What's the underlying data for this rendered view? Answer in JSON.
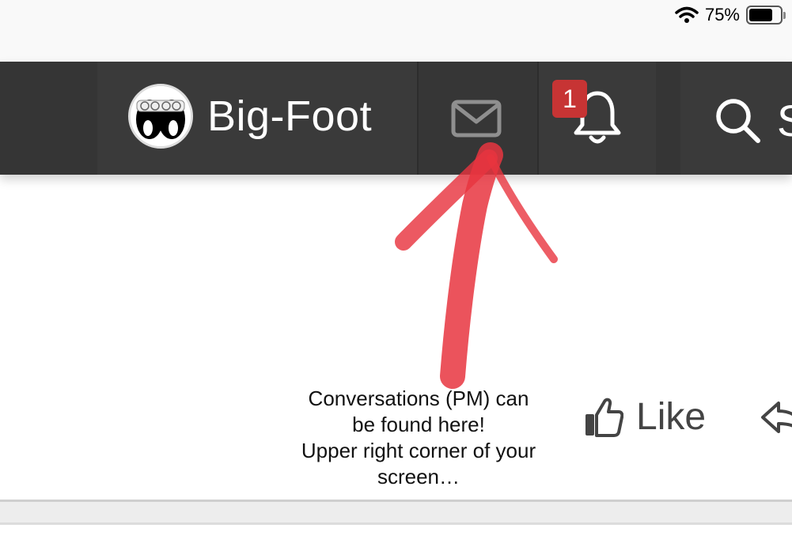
{
  "status_bar": {
    "battery": "75%",
    "battery_level": 0.75
  },
  "nav": {
    "username": "Big-Foot",
    "notification_count": "1",
    "search_text": "S"
  },
  "annotation": {
    "lines": [
      "Conversations (PM) can",
      "be found here!",
      "Upper right corner of your",
      "screen…"
    ]
  },
  "actions": {
    "like_label": "Like"
  },
  "icons": {
    "wifi": "wifi-icon",
    "battery": "battery-icon",
    "avatar": "moon-eyes-avatar",
    "mail": "envelope-icon",
    "bell": "bell-icon",
    "search": "search-icon",
    "like": "thumbs-up-icon",
    "reply": "reply-arrow-icon",
    "arrow": "red-arrow-annotation"
  },
  "colors": {
    "navbar": "#353535",
    "badge": "#c73434",
    "arrow": "#e8353f"
  }
}
